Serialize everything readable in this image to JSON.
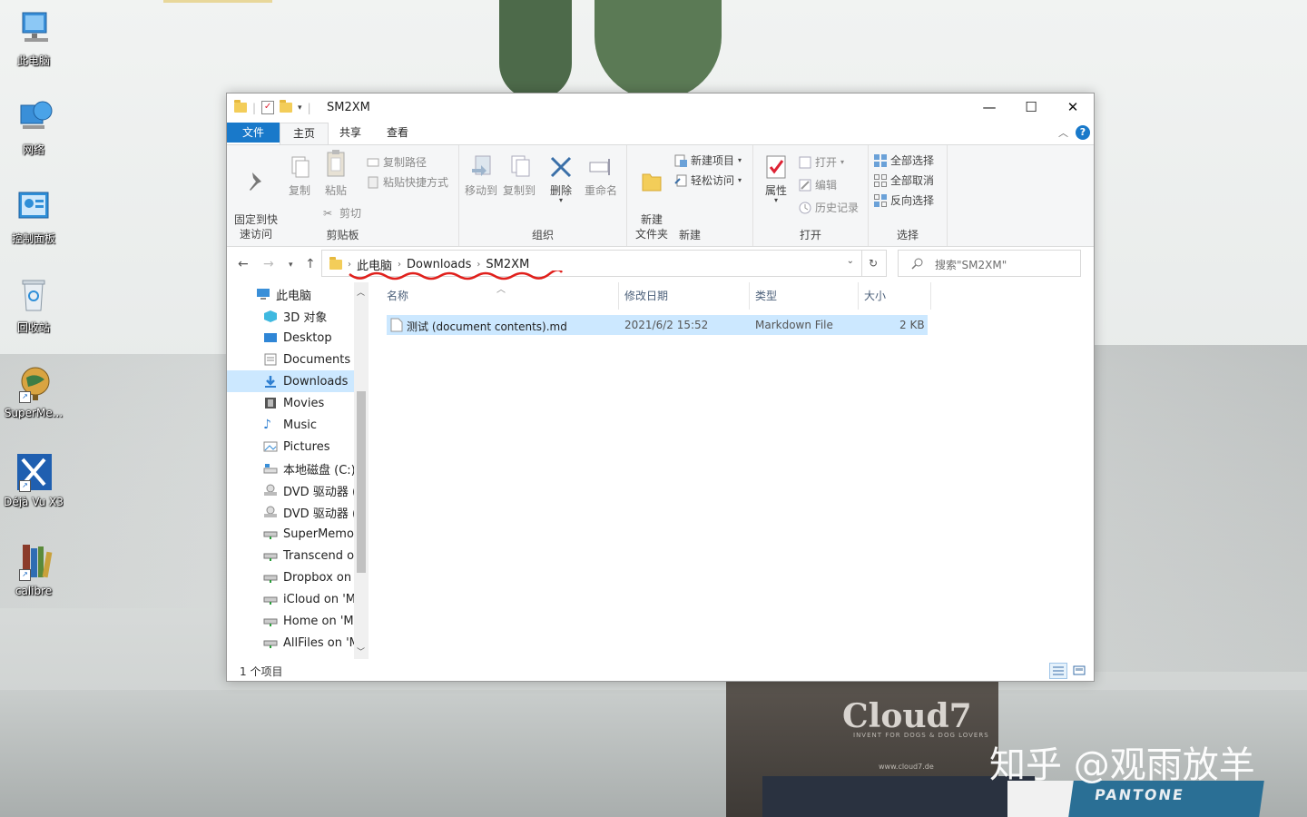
{
  "desktop": {
    "icons": [
      {
        "label": "此电脑",
        "icon": "computer-icon"
      },
      {
        "label": "网络",
        "icon": "network-icon"
      },
      {
        "label": "控制面板",
        "icon": "control-panel-icon"
      },
      {
        "label": "回收站",
        "icon": "recycle-bin-icon"
      },
      {
        "label": "SuperMe...",
        "icon": "globe-icon"
      },
      {
        "label": "Déjà Vu X3",
        "icon": "dejavu-icon"
      },
      {
        "label": "calibre",
        "icon": "books-icon"
      }
    ],
    "background_text": {
      "box_brand": "Cloud7",
      "box_sub": "INVENT FOR DOGS & DOG LOVERS",
      "box_url": "www.cloud7.de",
      "book_brand": "PANTONE",
      "watermark": "知乎 @观雨放羊"
    }
  },
  "window": {
    "title": "SM2XM",
    "controls": {
      "minimize": "—",
      "maximize": "☐",
      "close": "✕"
    },
    "menu": {
      "file": "文件",
      "tabs": [
        "主页",
        "共享",
        "查看"
      ],
      "active_tab": "主页",
      "help": "?"
    },
    "ribbon": {
      "clipboard": {
        "label": "剪贴板",
        "pin": "固定到快\n速访问",
        "copy": "复制",
        "paste": "粘贴",
        "cut": "剪切",
        "copy_path": "复制路径",
        "paste_shortcut": "粘贴快捷方式"
      },
      "organize": {
        "label": "组织",
        "move_to": "移动到",
        "copy_to": "复制到",
        "delete": "删除",
        "rename": "重命名"
      },
      "new": {
        "label": "新建",
        "new_folder": "新建\n文件夹",
        "new_item": "新建项目",
        "easy_access": "轻松访问"
      },
      "open": {
        "label": "打开",
        "properties": "属性",
        "open": "打开",
        "edit": "编辑",
        "history": "历史记录"
      },
      "select": {
        "label": "选择",
        "select_all": "全部选择",
        "select_none": "全部取消",
        "invert": "反向选择"
      }
    },
    "address": {
      "crumbs": [
        "此电脑",
        "Downloads",
        "SM2XM"
      ],
      "search_placeholder": "搜索\"SM2XM\""
    },
    "nav_pane": [
      {
        "label": "此电脑",
        "icon": "computer-icon"
      },
      {
        "label": "3D 对象",
        "icon": "3d-objects-icon"
      },
      {
        "label": "Desktop",
        "icon": "desktop-icon"
      },
      {
        "label": "Documents",
        "icon": "documents-icon"
      },
      {
        "label": "Downloads",
        "icon": "downloads-icon",
        "selected": true
      },
      {
        "label": "Movies",
        "icon": "movies-icon"
      },
      {
        "label": "Music",
        "icon": "music-icon"
      },
      {
        "label": "Pictures",
        "icon": "pictures-icon"
      },
      {
        "label": "本地磁盘 (C:)",
        "icon": "local-disk-icon"
      },
      {
        "label": "DVD 驱动器 (D",
        "icon": "dvd-drive-icon"
      },
      {
        "label": "DVD 驱动器 (E",
        "icon": "dvd-drive-icon"
      },
      {
        "label": "SuperMemo (",
        "icon": "network-drive-icon"
      },
      {
        "label": "Transcend on",
        "icon": "network-drive-icon"
      },
      {
        "label": "Dropbox on '",
        "icon": "network-drive-icon"
      },
      {
        "label": "iCloud on 'Ma",
        "icon": "network-drive-icon"
      },
      {
        "label": "Home on 'Ma",
        "icon": "network-drive-icon"
      },
      {
        "label": "AllFiles on 'M",
        "icon": "network-drive-icon"
      }
    ],
    "columns": [
      "名称",
      "修改日期",
      "类型",
      "大小"
    ],
    "files": [
      {
        "name": "测试 (document contents).md",
        "modified": "2021/6/2 15:52",
        "type": "Markdown File",
        "size": "2 KB",
        "selected": true
      }
    ],
    "status": "1 个项目",
    "accent": "#1979ca",
    "selection": "#cce8ff"
  }
}
